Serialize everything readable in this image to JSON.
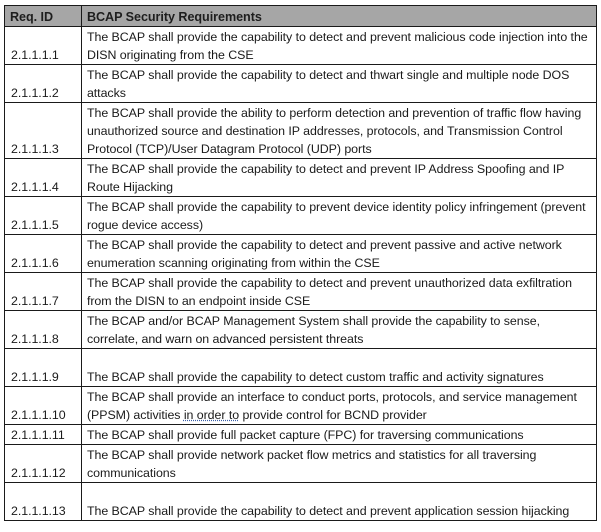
{
  "table": {
    "headers": {
      "id": "Req. ID",
      "requirement": "BCAP Security Requirements"
    },
    "header_bg_color": "#a6a6a6",
    "rows": [
      {
        "id": "2.1.1.1.1",
        "text": "The BCAP shall provide the capability to detect and prevent malicious code injection into the DISN originating from the CSE"
      },
      {
        "id": "2.1.1.1.2",
        "text": "The BCAP shall provide the capability to detect and thwart single and multiple node DOS attacks"
      },
      {
        "id": "2.1.1.1.3",
        "text": "The BCAP shall provide the ability to perform detection and prevention of traffic flow having unauthorized source and destination IP addresses, protocols, and Transmission Control Protocol (TCP)/User Datagram Protocol (UDP) ports"
      },
      {
        "id": "2.1.1.1.4",
        "text": "The BCAP shall provide the capability to detect and prevent IP Address Spoofing and IP Route Hijacking"
      },
      {
        "id": "2.1.1.1.5",
        "text": "The BCAP shall provide the capability to prevent device identity policy infringement (prevent rogue device access)"
      },
      {
        "id": "2.1.1.1.6",
        "text": "The BCAP shall provide the capability to detect and prevent passive and active network enumeration scanning originating from within the CSE"
      },
      {
        "id": "2.1.1.1.7",
        "text": " The BCAP shall provide the capability to detect and prevent unauthorized data exfiltration from the DISN to an endpoint inside CSE"
      },
      {
        "id": "2.1.1.1.8",
        "text": "The BCAP and/or BCAP Management System shall provide the capability to sense, correlate, and warn on advanced persistent threats"
      },
      {
        "id": "2.1.1.1.9",
        "text": " The BCAP shall provide the capability to detect custom traffic and activity signatures"
      },
      {
        "id": "2.1.1.1.10",
        "text_before": "The BCAP shall provide an interface to conduct ports, protocols, and service management (PPSM) activities ",
        "text_underlined": "in order to",
        "text_after": " provide control for BCND provider"
      },
      {
        "id": "2.1.1.1.11",
        "text": "The BCAP shall provide full packet capture (FPC) for traversing communications"
      },
      {
        "id": "2.1.1.1.12",
        "text": "The BCAP shall provide network packet flow metrics and statistics for all traversing communications"
      },
      {
        "id": "2.1.1.1.13",
        "text": "The BCAP shall provide the capability to detect and prevent application session hijacking"
      }
    ]
  }
}
